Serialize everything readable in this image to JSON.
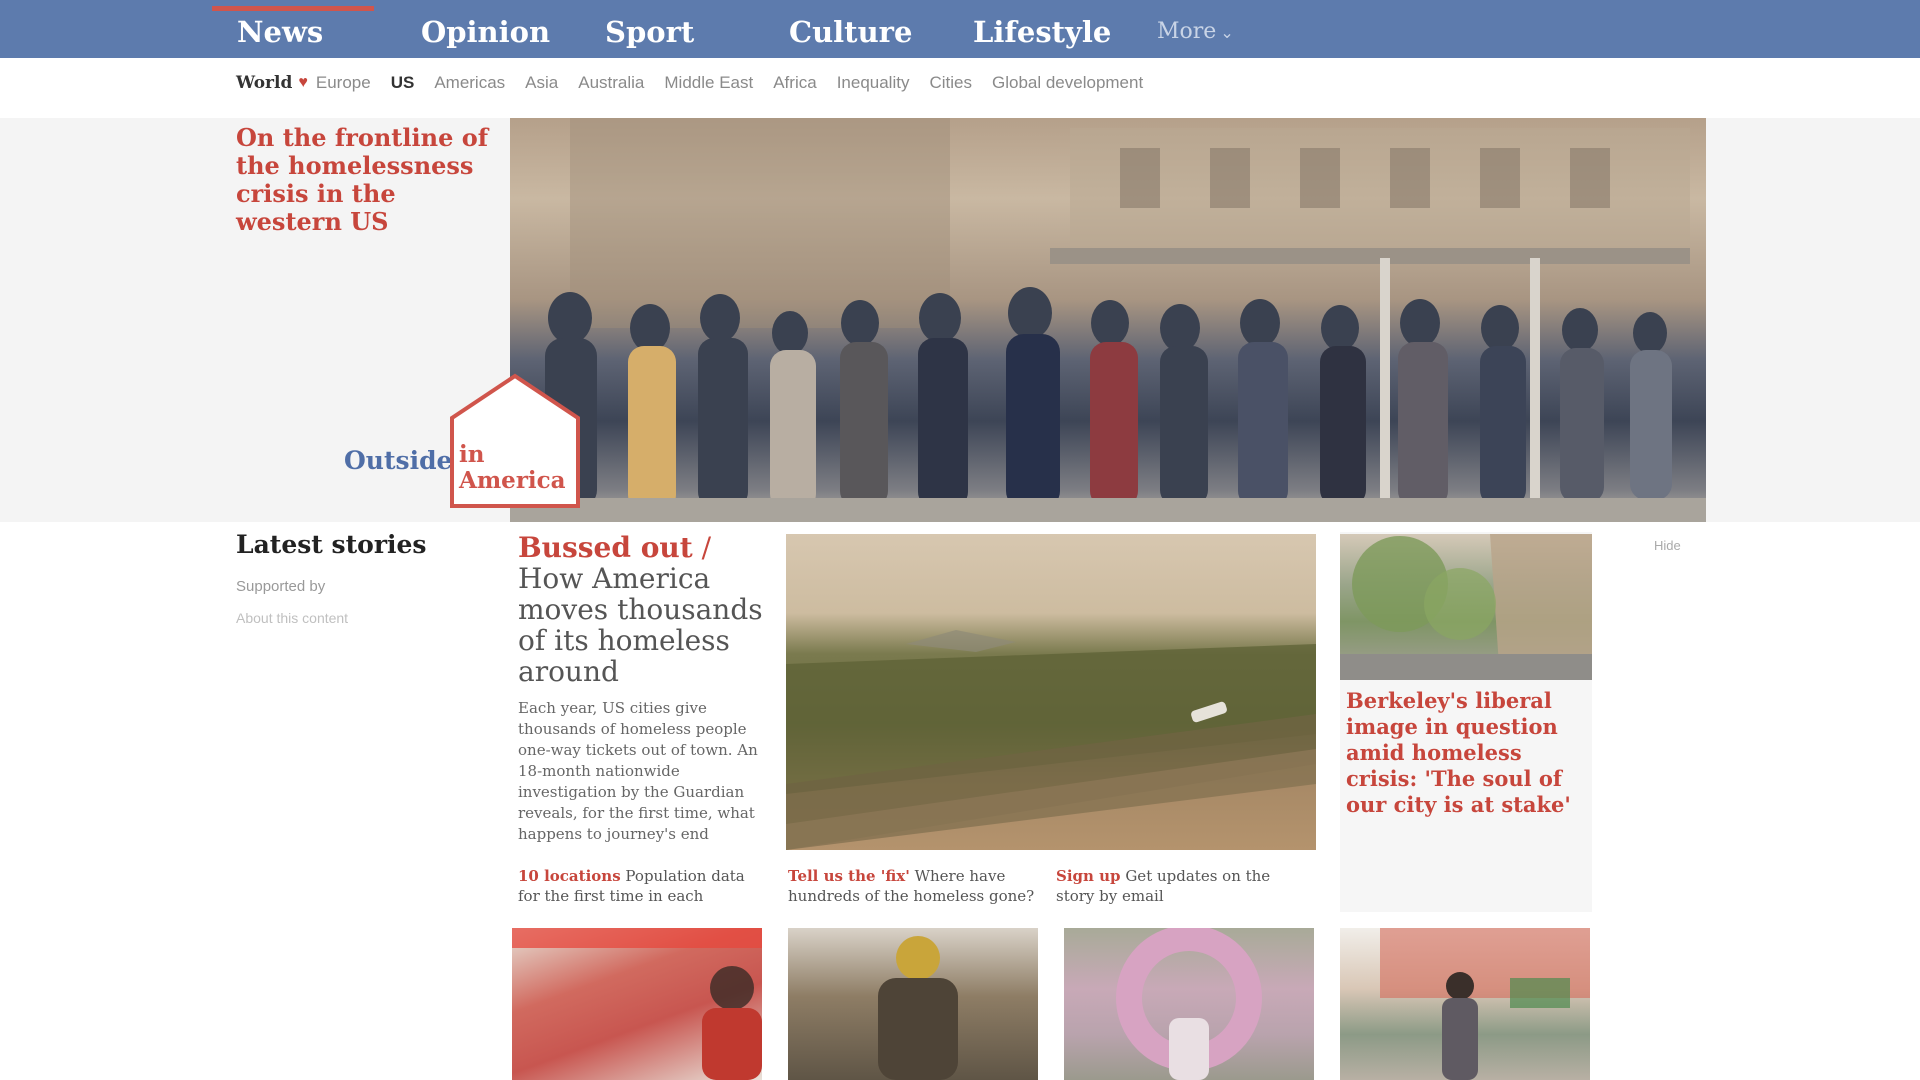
{
  "nav": {
    "pillars": [
      {
        "label": "News",
        "active": true
      },
      {
        "label": "Opinion",
        "active": false
      },
      {
        "label": "Sport",
        "active": false
      },
      {
        "label": "Culture",
        "active": false
      },
      {
        "label": "Lifestyle",
        "active": false
      }
    ],
    "more_label": "More"
  },
  "subnav": {
    "world": "World",
    "items": [
      "Europe",
      "US",
      "Americas",
      "Asia",
      "Australia",
      "Middle East",
      "Africa",
      "Inequality",
      "Cities",
      "Global development"
    ],
    "current": "US"
  },
  "hero": {
    "headline": "On the frontline of the homelessness crisis in the western US",
    "badge_outside": "Outside",
    "badge_in": "in",
    "badge_america": "America"
  },
  "latest": {
    "title": "Latest stories",
    "subtitle": "Supported by",
    "about": "About this content"
  },
  "main_story": {
    "kicker": "Bussed out",
    "headline": "How America moves thousands of its homeless around",
    "standfirst": "Each year, US cities give thousands of homeless people one-way tickets out of town. An 18-month nationwide investigation by the Guardian reveals, for the first time, what happens to journey's end"
  },
  "sublinks": [
    {
      "kicker": "10 locations",
      "text": "Population data for the first time in each"
    },
    {
      "kicker": "Tell us the 'fix'",
      "text": "Where have hundreds of the homeless gone?"
    },
    {
      "kicker": "Sign up",
      "text": "Get updates on the story by email"
    }
  ],
  "right_story": {
    "headline": "Berkeley's liberal image in question amid homeless crisis: 'The soul of our city is at stake'",
    "hide": "Hide"
  },
  "colors": {
    "nav_blue": "#5d7bad",
    "accent_red": "#c7463c",
    "badge_blue": "#4f6ea7"
  }
}
